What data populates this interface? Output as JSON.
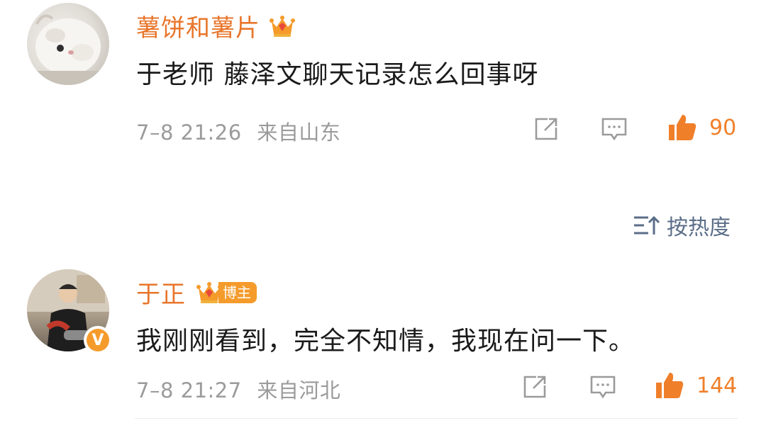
{
  "comments": [
    {
      "username": "薯饼和薯片",
      "badge_icon": "crown-badge",
      "text": "于老师 藤泽文聊天记录怎么回事呀",
      "timestamp": "7–8 21:26",
      "location": "来自山东",
      "likes": "90"
    },
    {
      "username": "于正",
      "badge_icon": "crown-badge",
      "badge_label": "博主",
      "verified_label": "V",
      "text": "我刚刚看到，完全不知情，我现在问一下。",
      "timestamp": "7–8 21:27",
      "location": "来自河北",
      "likes": "144"
    }
  ],
  "sort": {
    "label": "按热度",
    "icon": "sort-icon"
  },
  "colors": {
    "username": "#e8762b",
    "like": "#f07f2a",
    "meta": "#9b9b9b",
    "sort": "#5b6e88",
    "badge": "#f59b2b"
  }
}
